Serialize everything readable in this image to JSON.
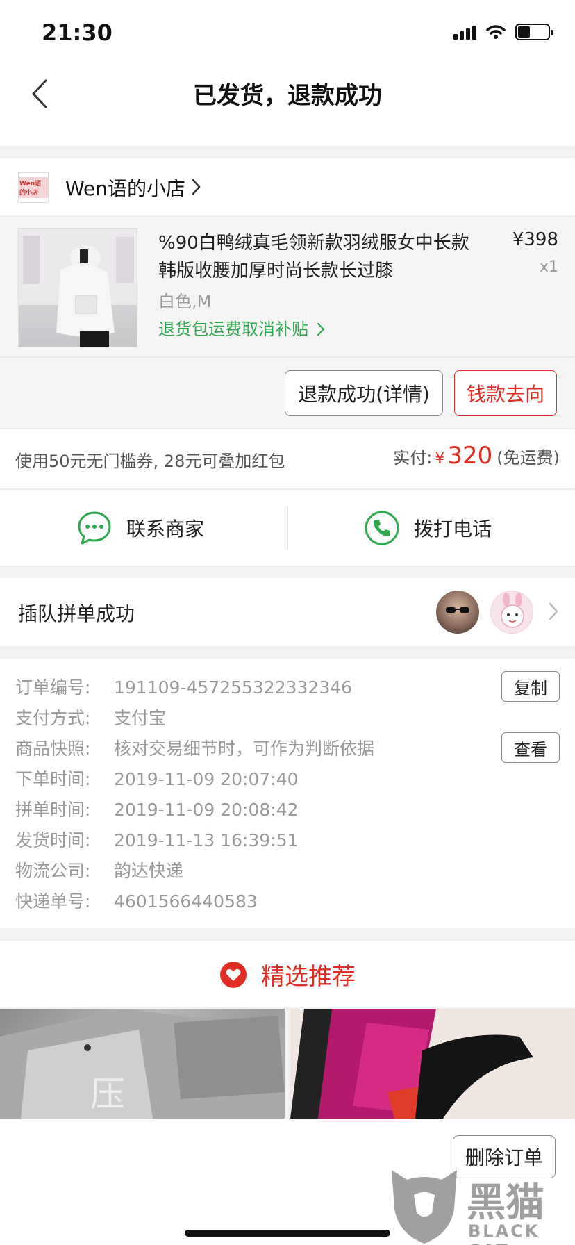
{
  "status_bar": {
    "time": "21:30"
  },
  "nav": {
    "title": "已发货，退款成功"
  },
  "shop": {
    "logo_text": "Wen语的小店",
    "name": "Wen语的小店"
  },
  "product": {
    "title": "%90白鸭绒真毛领新款羽绒服女中长款韩版收腰加厚时尚长款长过膝",
    "price": "¥398",
    "qty": "x1",
    "spec": "白色,M",
    "link": "退货包运费取消补贴"
  },
  "actions": {
    "detail_label": "退款成功(详情)",
    "money_label": "钱款去向"
  },
  "payment": {
    "coupon_text": "使用50元无门槛券, 28元可叠加红包",
    "paid_label": "实付:",
    "paid_yen": "¥",
    "paid_amount": "320",
    "paid_note": "(免运费)"
  },
  "contact": {
    "merchant_label": "联系商家",
    "phone_label": "拨打电话"
  },
  "group": {
    "text": "插队拼单成功"
  },
  "order_info": {
    "rows": [
      {
        "key": "订单编号:",
        "value": "191109-457255322332346"
      },
      {
        "key": "支付方式:",
        "value": "支付宝"
      },
      {
        "key": "商品快照:",
        "value": "核对交易细节时，可作为判断依据"
      },
      {
        "key": "下单时间:",
        "value": "2019-11-09 20:07:40"
      },
      {
        "key": "拼单时间:",
        "value": "2019-11-09 20:08:42"
      },
      {
        "key": "发货时间:",
        "value": "2019-11-13 16:39:51"
      },
      {
        "key": "物流公司:",
        "value": "韵达快递"
      },
      {
        "key": "快递单号:",
        "value": "4601566440583"
      }
    ],
    "copy_label": "复制",
    "view_label": "查看"
  },
  "recommend": {
    "title": "精选推荐"
  },
  "bottom": {
    "delete_label": "删除订单"
  },
  "watermark": {
    "text": "黑猫",
    "sub": "BLACK CAT"
  },
  "colors": {
    "accent_red": "#e02e24",
    "green": "#2fa84f",
    "bg_gray": "#f2f2f2"
  }
}
